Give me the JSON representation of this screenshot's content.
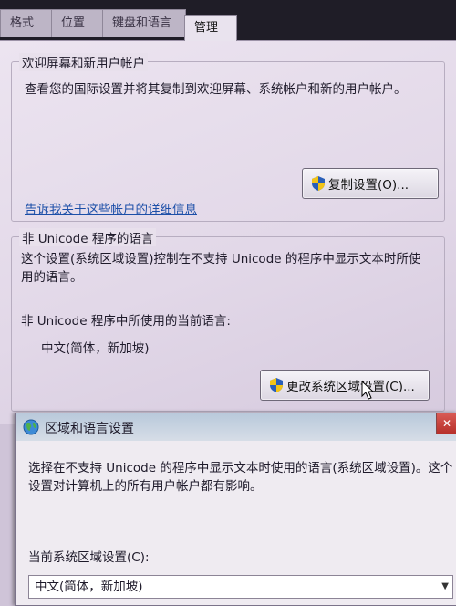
{
  "tabs": [
    {
      "label": "格式"
    },
    {
      "label": "位置"
    },
    {
      "label": "键盘和语言"
    },
    {
      "label": "管理"
    }
  ],
  "welcome_group": {
    "title": "欢迎屏幕和新用户帐户",
    "description": "查看您的国际设置并将其复制到欢迎屏幕、系统帐户和新的用户帐户。",
    "copy_button": "复制设置(O)...",
    "link": "告诉我关于这些帐户的详细信息"
  },
  "nonunicode_group": {
    "title": "非 Unicode 程序的语言",
    "description": "这个设置(系统区域设置)控制在不支持 Unicode 的程序中显示文本时所使用的语言。",
    "current_label": "非 Unicode 程序中所使用的当前语言:",
    "current_value": "中文(简体，新加坡)",
    "change_button": "更改系统区域设置(C)..."
  },
  "dialog": {
    "title": "区域和语言设置",
    "close_label": "✕",
    "description": "选择在不支持 Unicode 的程序中显示文本时使用的语言(系统区域设置)。这个设置对计算机上的所有用户帐户都有影响。",
    "locale_label": "当前系统区域设置(C):",
    "locale_value": "中文(简体，新加坡)"
  }
}
